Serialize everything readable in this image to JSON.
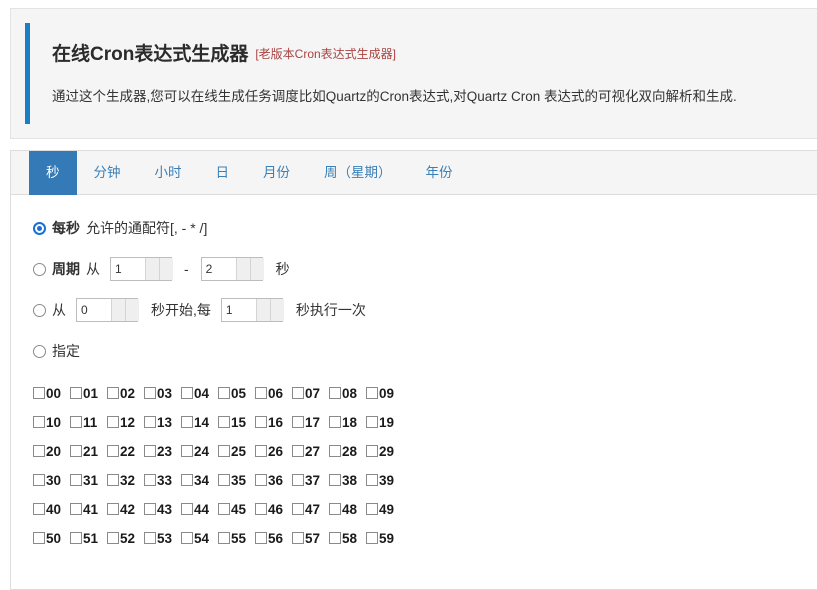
{
  "header": {
    "title": "在线Cron表达式生成器",
    "link_label": "[老版本Cron表达式生成器]",
    "description": "通过这个生成器,您可以在线生成任务调度比如Quartz的Cron表达式,对Quartz Cron 表达式的可视化双向解析和生成.",
    "accent_color": "#1b7fc4",
    "link_color": "#a94442"
  },
  "tabs": [
    {
      "label": "秒",
      "active": true
    },
    {
      "label": "分钟",
      "active": false
    },
    {
      "label": "小时",
      "active": false
    },
    {
      "label": "日",
      "active": false
    },
    {
      "label": "月份",
      "active": false
    },
    {
      "label": "周（星期）",
      "active": false
    },
    {
      "label": "年份",
      "active": false
    }
  ],
  "options": {
    "every": {
      "label": "每秒",
      "hint": "允许的通配符[, - * /]",
      "selected": true
    },
    "cycle": {
      "label": "周期",
      "from_word": "从",
      "start_value": "1",
      "dash": "-",
      "end_value": "2",
      "unit": "秒",
      "selected": false
    },
    "interval": {
      "from_word": "从",
      "start_value": "0",
      "mid_text": "秒开始,每",
      "step_value": "1",
      "tail_text": "秒执行一次",
      "selected": false
    },
    "specify": {
      "label": "指定",
      "selected": false
    }
  },
  "checkbox_grid": {
    "rows": [
      [
        "00",
        "01",
        "02",
        "03",
        "04",
        "05",
        "06",
        "07",
        "08",
        "09"
      ],
      [
        "10",
        "11",
        "12",
        "13",
        "14",
        "15",
        "16",
        "17",
        "18",
        "19"
      ],
      [
        "20",
        "21",
        "22",
        "23",
        "24",
        "25",
        "26",
        "27",
        "28",
        "29"
      ],
      [
        "30",
        "31",
        "32",
        "33",
        "34",
        "35",
        "36",
        "37",
        "38",
        "39"
      ],
      [
        "40",
        "41",
        "42",
        "43",
        "44",
        "45",
        "46",
        "47",
        "48",
        "49"
      ],
      [
        "50",
        "51",
        "52",
        "53",
        "54",
        "55",
        "56",
        "57",
        "58",
        "59"
      ]
    ]
  }
}
